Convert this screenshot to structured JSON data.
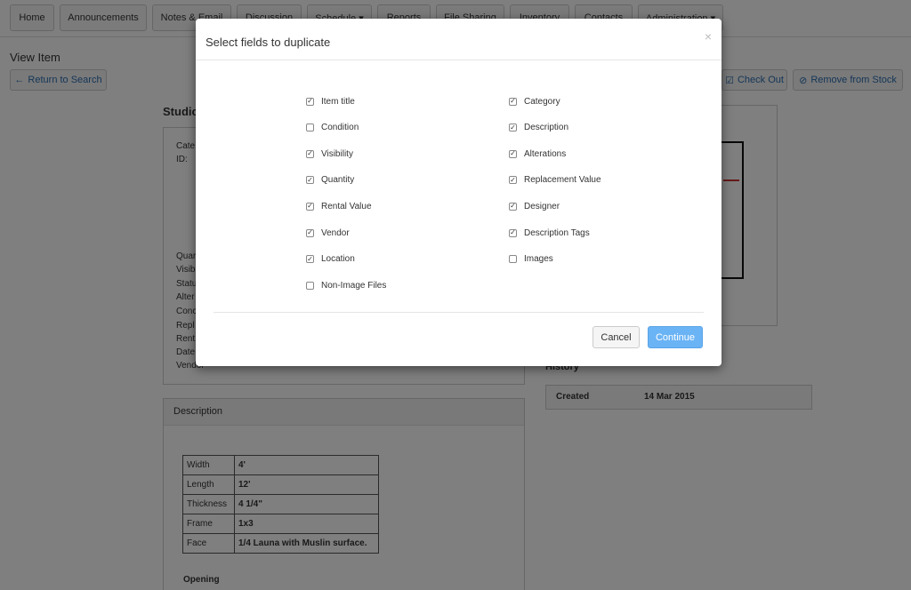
{
  "nav": {
    "tabs": [
      "Home",
      "Announcements",
      "Notes & Email",
      "Discussion",
      "Schedule ▾",
      "Reports",
      "File Sharing",
      "Inventory",
      "Contacts",
      "Administration ▾"
    ]
  },
  "page": {
    "title": "View Item",
    "return_button": "Return to Search",
    "checkout_button": "Check Out",
    "remove_button": "Remove from Stock",
    "item_heading": "Studic",
    "left_labels": [
      "Cate",
      "ID:",
      "Quar",
      "Visib",
      "Statu",
      "Alter",
      "Conc",
      "Repl",
      "Rent",
      "Date",
      "Vendor"
    ],
    "description_heading": "Description",
    "spec_table": [
      {
        "k": "Width",
        "v": "4'"
      },
      {
        "k": "Length",
        "v": "12'"
      },
      {
        "k": "Thickness",
        "v": "4 1/4\""
      },
      {
        "k": "Frame",
        "v": "1x3"
      },
      {
        "k": "Face",
        "v": "1/4 Launa with Muslin surface."
      }
    ],
    "opening_label": "Opening",
    "history_heading": "History",
    "history_row": {
      "label": "Created",
      "value": "14 Mar 2015"
    }
  },
  "modal": {
    "title": "Select fields to duplicate",
    "close": "×",
    "left_fields": [
      {
        "label": "Item title",
        "checked": true
      },
      {
        "label": "Condition",
        "checked": false
      },
      {
        "label": "Visibility",
        "checked": true
      },
      {
        "label": "Quantity",
        "checked": true
      },
      {
        "label": "Rental Value",
        "checked": true
      },
      {
        "label": "Vendor",
        "checked": true
      },
      {
        "label": "Location",
        "checked": true
      },
      {
        "label": "Non-Image Files",
        "checked": false
      }
    ],
    "right_fields": [
      {
        "label": "Category",
        "checked": true
      },
      {
        "label": "Description",
        "checked": true
      },
      {
        "label": "Alterations",
        "checked": true
      },
      {
        "label": "Replacement Value",
        "checked": true
      },
      {
        "label": "Designer",
        "checked": true
      },
      {
        "label": "Description Tags",
        "checked": true
      },
      {
        "label": "Images",
        "checked": false
      }
    ],
    "cancel": "Cancel",
    "continue": "Continue"
  }
}
